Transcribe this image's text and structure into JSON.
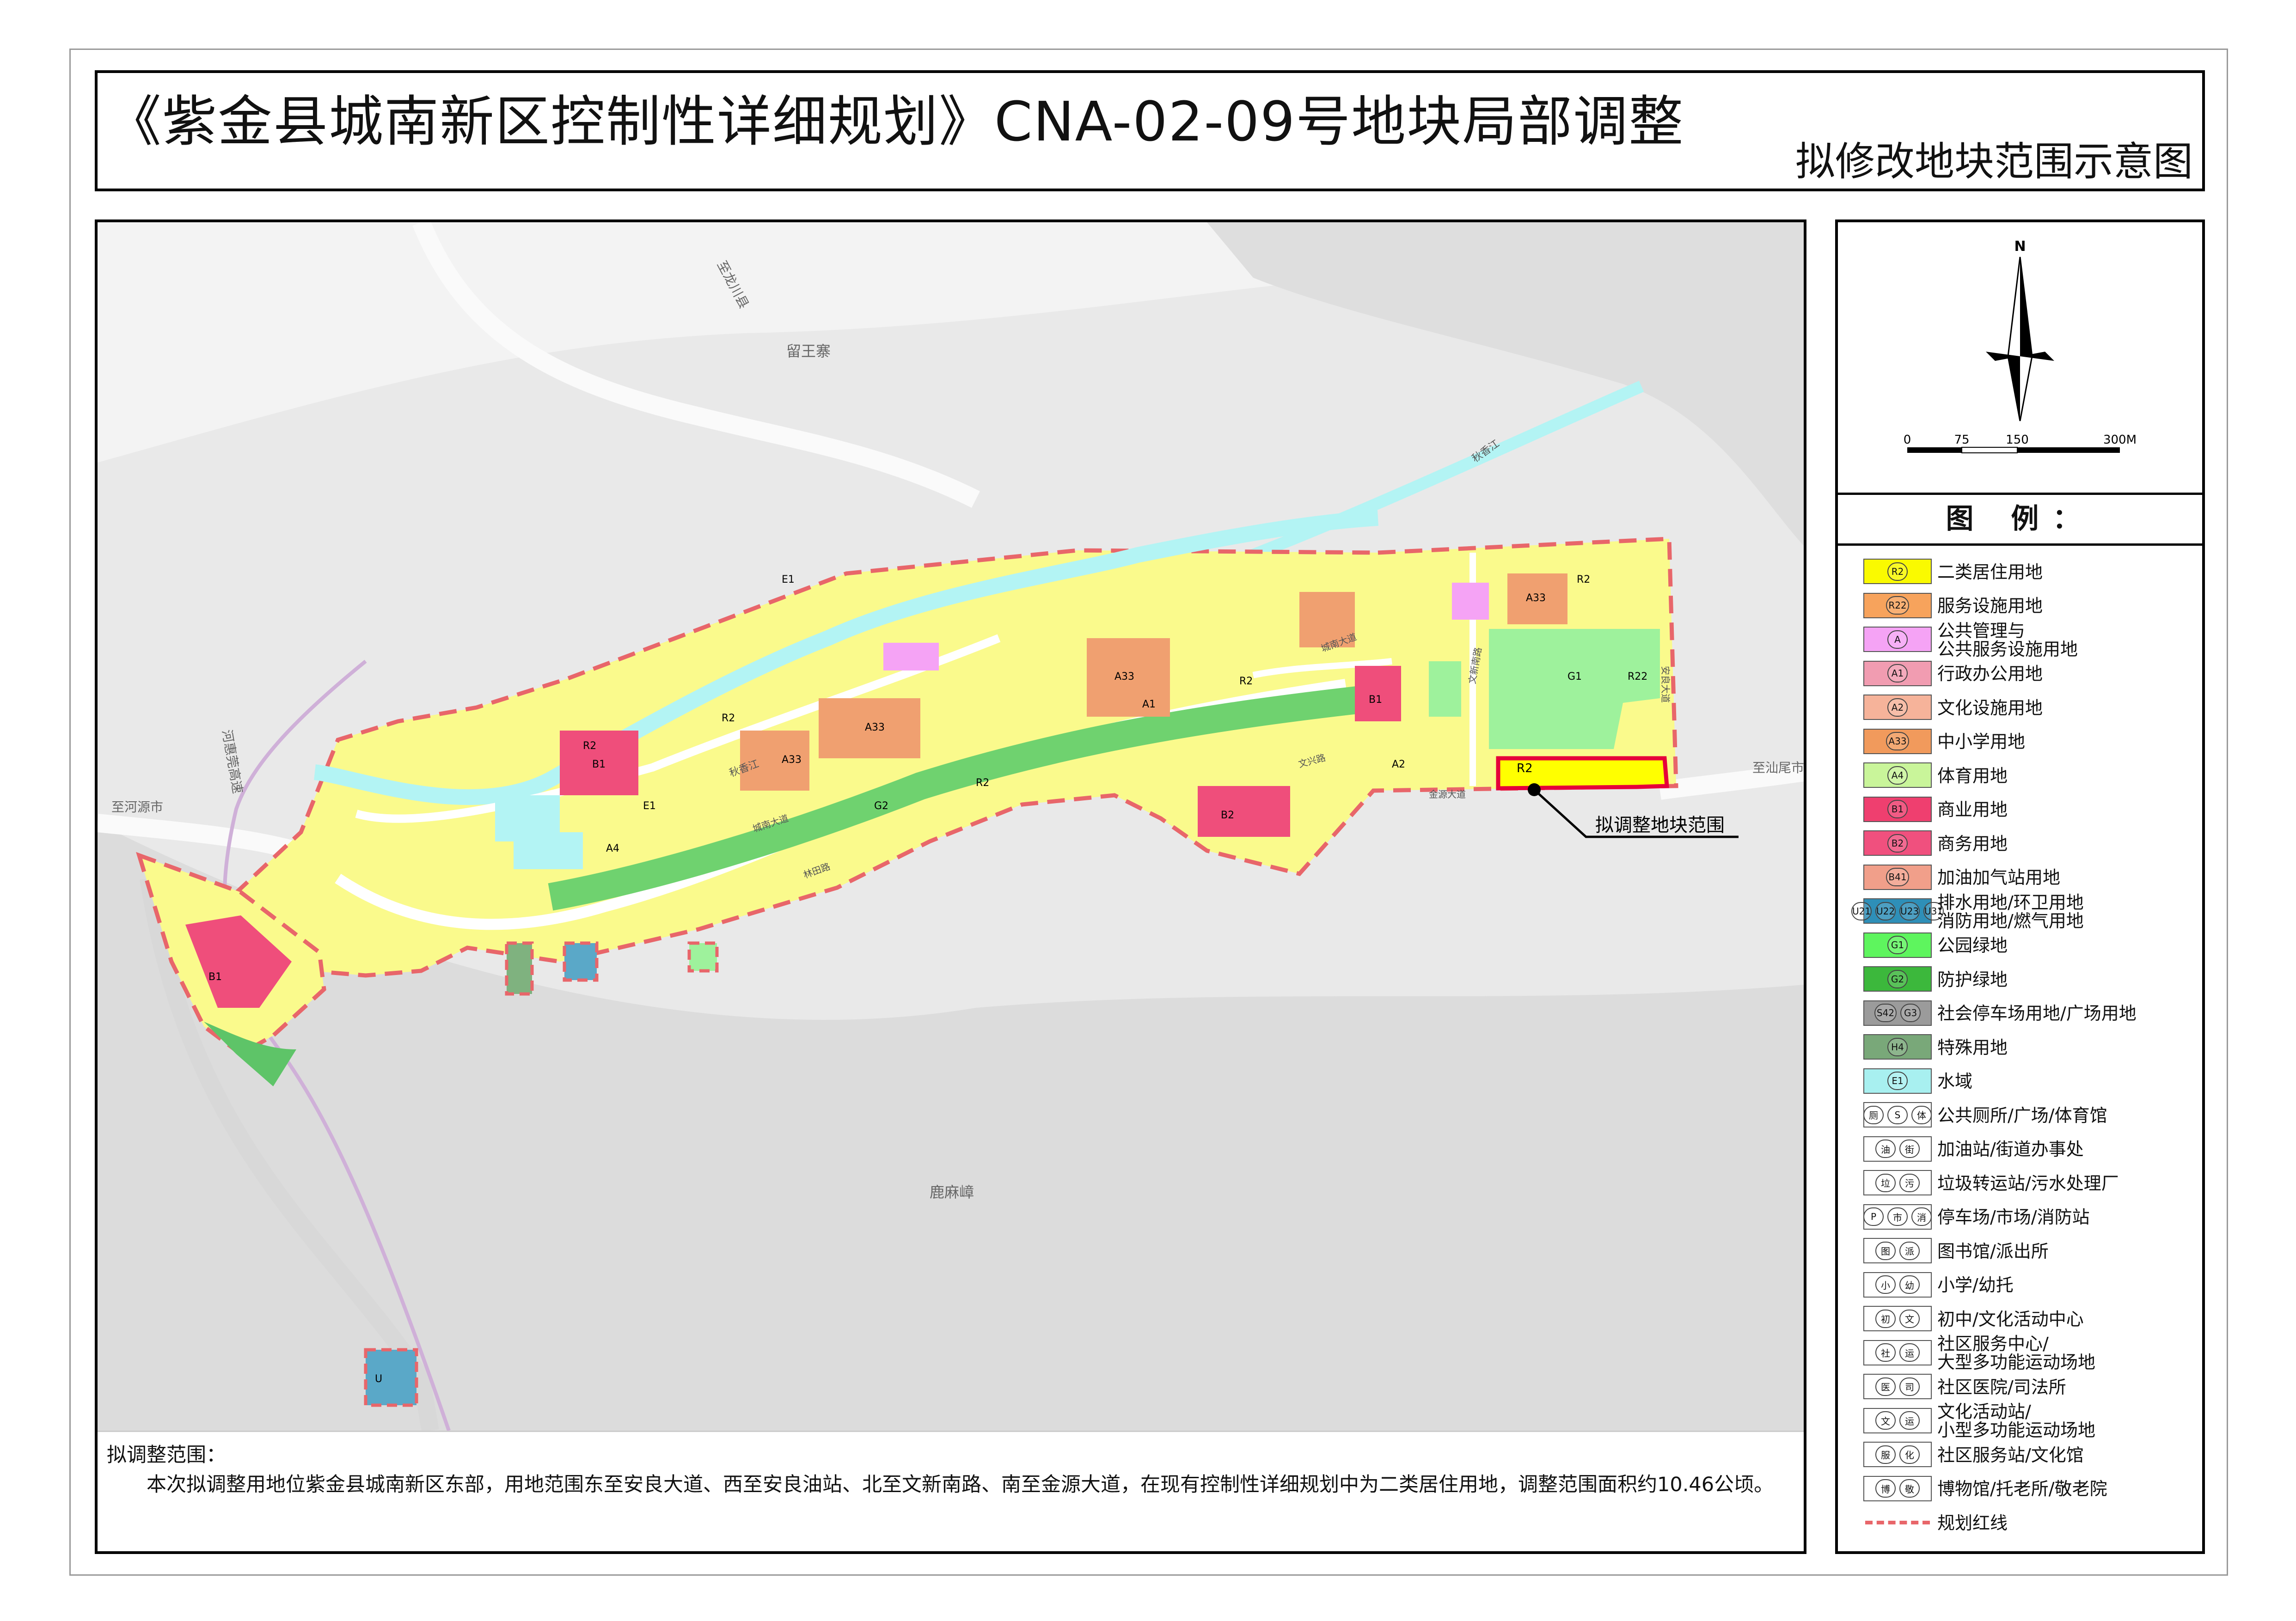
{
  "title": {
    "main": "《紫金县城南新区控制性详细规划》CNA-02-09号地块局部调整",
    "sub": "拟修改地块范围示意图"
  },
  "map": {
    "place_labels": {
      "liuwangzhai": "留王寨",
      "luwei": "鹿麻嶂",
      "to_longchuan": "至龙川县",
      "to_heyuan": "至河源市",
      "to_shanwei": "至汕尾市",
      "heshan_expressway": "河惠莞高速",
      "qiuxiang_river_n": "秋香江",
      "qiuxiang_river": "秋香江",
      "wenxin_road": "文新南路",
      "jinyuan_avenue": "金源大道",
      "anliang_avenue": "安良大道",
      "chengnan_avenue": "城南大道",
      "linshan_road": "林田路",
      "wenxing_road": "文兴路",
      "qingnan_avenue": "城南大道"
    },
    "callout": "拟调整地块范围",
    "zone_codes": {
      "r2": "R2",
      "r22": "R22",
      "a1": "A1",
      "a2": "A2",
      "a33": "A33",
      "a4": "A4",
      "b1": "B1",
      "b2": "B2",
      "g1": "G1",
      "g2": "G2",
      "e1": "E1",
      "u": "U"
    },
    "colors": {
      "r2": "#fafa8c",
      "r22": "#f4a460",
      "a": "#f5a3f5",
      "a1": "#f19cb1",
      "a2": "#f4b399",
      "a33": "#f0a070",
      "a4": "#c9f59a",
      "b1": "#ef4e7b",
      "b2": "#f0608a",
      "u": "#5aa8c8",
      "g1": "#9ef29c",
      "g2": "#5ec468",
      "s": "#a9a9a9",
      "h4": "#7fb27f",
      "e1": "#b3f4f4",
      "redline": "#e8666a",
      "highlight": "#ffff00"
    }
  },
  "note": {
    "heading": "拟调整范围：",
    "body": "本次拟调整用地位紫金县城南新区东部，用地范围东至安良大道、西至安良油站、北至文新南路、南至金源大道，在现有控制性详细规划中为二类居住用地，调整范围面积约10.46公顷。"
  },
  "compass": {
    "north": "N",
    "scale_ticks": [
      "0",
      "75",
      "150",
      "300M"
    ]
  },
  "legend": {
    "heading": "图 例：",
    "items": [
      {
        "codes": [
          "R2"
        ],
        "color": "#fafa00",
        "label": "二类居住用地"
      },
      {
        "codes": [
          "R22"
        ],
        "color": "#f7a35c",
        "label": "服务设施用地"
      },
      {
        "codes": [
          "A"
        ],
        "color": "#f5a3f5",
        "label": "公共管理与\n公共服务设施用地"
      },
      {
        "codes": [
          "A1"
        ],
        "color": "#f19cb1",
        "label": "行政办公用地"
      },
      {
        "codes": [
          "A2"
        ],
        "color": "#f6b39a",
        "label": "文化设施用地"
      },
      {
        "codes": [
          "A33"
        ],
        "color": "#f19a5c",
        "label": "中小学用地"
      },
      {
        "codes": [
          "A4"
        ],
        "color": "#c9f59a",
        "label": "体育用地"
      },
      {
        "codes": [
          "B1"
        ],
        "color": "#ef3f6f",
        "label": "商业用地"
      },
      {
        "codes": [
          "B2"
        ],
        "color": "#f0507e",
        "label": "商务用地"
      },
      {
        "codes": [
          "B41"
        ],
        "color": "#f19f8a",
        "label": "加油加气站用地"
      },
      {
        "codes": [
          "U21",
          "U22",
          "U23",
          "U31"
        ],
        "color": "#2e8fb8",
        "label": "排水用地/环卫用地\n消防用地/燃气用地"
      },
      {
        "codes": [
          "G1"
        ],
        "color": "#5ef55e",
        "label": "公园绿地"
      },
      {
        "codes": [
          "G2"
        ],
        "color": "#3cb83c",
        "label": "防护绿地"
      },
      {
        "codes": [
          "S42",
          "G3"
        ],
        "color": "#9b9b9b",
        "label": "社会停车场用地/广场用地"
      },
      {
        "codes": [
          "H4"
        ],
        "color": "#79a879",
        "label": "特殊用地"
      },
      {
        "codes": [
          "E1"
        ],
        "color": "#a8f0f0",
        "label": "水域"
      },
      {
        "codes": [
          "厕",
          "S",
          "体"
        ],
        "color": "#ffffff",
        "label": "公共厕所/广场/体育馆"
      },
      {
        "codes": [
          "油",
          "街"
        ],
        "color": "#ffffff",
        "label": "加油站/街道办事处"
      },
      {
        "codes": [
          "垃",
          "污"
        ],
        "color": "#ffffff",
        "label": "垃圾转运站/污水处理厂"
      },
      {
        "codes": [
          "P",
          "市",
          "消"
        ],
        "color": "#ffffff",
        "label": "停车场/市场/消防站"
      },
      {
        "codes": [
          "图",
          "派"
        ],
        "color": "#ffffff",
        "label": "图书馆/派出所"
      },
      {
        "codes": [
          "小",
          "幼"
        ],
        "color": "#ffffff",
        "label": "小学/幼托"
      },
      {
        "codes": [
          "初",
          "文"
        ],
        "color": "#ffffff",
        "label": "初中/文化活动中心"
      },
      {
        "codes": [
          "社",
          "运"
        ],
        "color": "#ffffff",
        "label": "社区服务中心/\n大型多功能运动场地"
      },
      {
        "codes": [
          "医",
          "司"
        ],
        "color": "#ffffff",
        "label": "社区医院/司法所"
      },
      {
        "codes": [
          "文",
          "运"
        ],
        "color": "#ffffff",
        "label": "文化活动站/\n小型多功能运动场地"
      },
      {
        "codes": [
          "服",
          "化"
        ],
        "color": "#ffffff",
        "label": "社区服务站/文化馆"
      },
      {
        "codes": [
          "博",
          "敬"
        ],
        "color": "#ffffff",
        "label": "博物馆/托老所/敬老院"
      },
      {
        "codes": [],
        "color": "#e8666a",
        "label": "规划红线",
        "line": true
      }
    ]
  }
}
